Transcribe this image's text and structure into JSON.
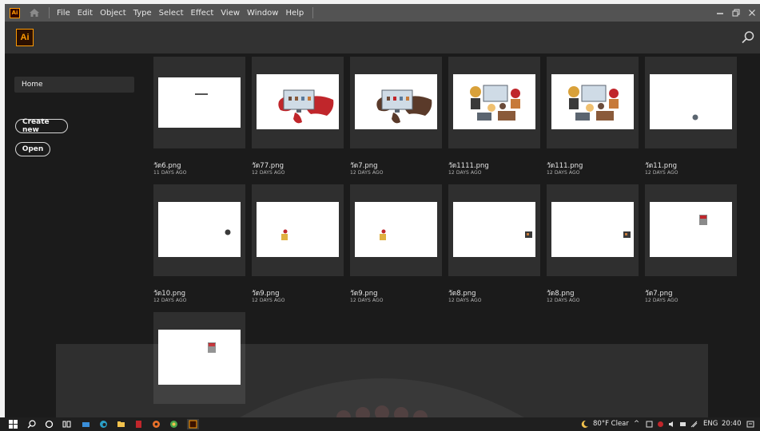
{
  "menubar": {
    "items": [
      "File",
      "Edit",
      "Object",
      "Type",
      "Select",
      "Effect",
      "View",
      "Window",
      "Help"
    ],
    "app_icon_text": "Ai"
  },
  "header": {
    "logo_text": "Ai"
  },
  "sidebar": {
    "home_label": "Home",
    "create_new_label": "Create new",
    "open_label": "Open"
  },
  "files": [
    {
      "name": "วัด6.png",
      "date": "11 DAYS AGO",
      "thumb": "text"
    },
    {
      "name": "วัด77.png",
      "date": "12 DAYS AGO",
      "thumb": "map"
    },
    {
      "name": "วัด7.png",
      "date": "12 DAYS AGO",
      "thumb": "map"
    },
    {
      "name": "วัด1111.png",
      "date": "12 DAYS AGO",
      "thumb": "people"
    },
    {
      "name": "วัด111.png",
      "date": "12 DAYS AGO",
      "thumb": "people"
    },
    {
      "name": "วัด11.png",
      "date": "12 DAYS AGO",
      "thumb": "dot-center"
    },
    {
      "name": "วัด10.png",
      "date": "12 DAYS AGO",
      "thumb": "dot-right"
    },
    {
      "name": "วัด9.png",
      "date": "12 DAYS AGO",
      "thumb": "figure-left"
    },
    {
      "name": "วัด9.png",
      "date": "12 DAYS AGO",
      "thumb": "figure-left"
    },
    {
      "name": "วัด8.png",
      "date": "12 DAYS AGO",
      "thumb": "box-right"
    },
    {
      "name": "วัด8.png",
      "date": "12 DAYS AGO",
      "thumb": "box-right"
    },
    {
      "name": "วัด7.png",
      "date": "12 DAYS AGO",
      "thumb": "box-top"
    },
    {
      "name": "",
      "date": "",
      "thumb": "box-top"
    }
  ],
  "taskbar": {
    "weather": "80°F  Clear",
    "language": "ENG",
    "time": "20:40"
  },
  "colors": {
    "accent": "#ff9a00",
    "background": "#1b1b1b",
    "panel": "#2f2f2f",
    "menubar": "#535353"
  }
}
